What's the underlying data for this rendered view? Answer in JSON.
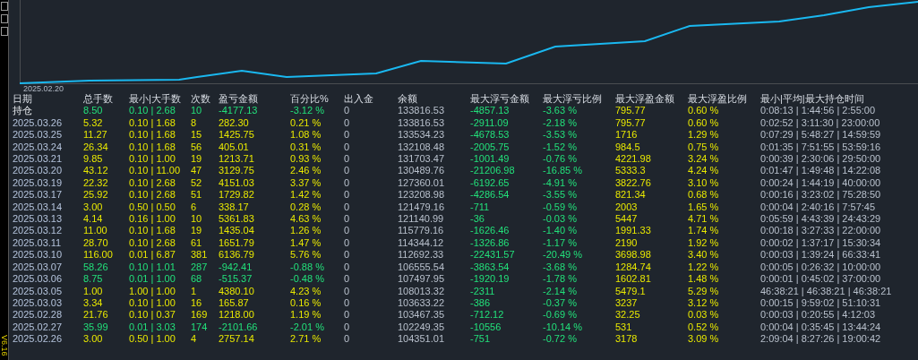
{
  "sidebar": {
    "version": "V6.16"
  },
  "chart": {
    "start_label": "2025.02.20"
  },
  "table": {
    "columns": [
      "日期",
      "总手数",
      "最小|大手数",
      "次数",
      "盈亏金额",
      "百分比%",
      "出入金",
      "余额",
      "最大浮亏金额",
      "最大浮亏比例",
      "最大浮盈金额",
      "最大浮盈比例",
      "最小|平均|最大持仓时间"
    ],
    "rows": [
      {
        "kind": "loss",
        "cells": [
          "持仓",
          "8.50",
          "0.10 | 2.68",
          "10",
          "-4177.13",
          "-3.12 %",
          "0",
          "133816.53",
          "-4857.13",
          "-3.63 %",
          "795.77",
          "0.60 %",
          "0:08:13 | 1:44:56 | 2:55:00"
        ]
      },
      {
        "kind": "profit",
        "cells": [
          "2025.03.26",
          "5.32",
          "0.10 | 1.68",
          "8",
          "282.30",
          "0.21 %",
          "0",
          "133816.53",
          "-2911.09",
          "-2.18 %",
          "795.77",
          "0.60 %",
          "0:02:52 | 3:11:30 | 23:00:00"
        ]
      },
      {
        "kind": "profit",
        "cells": [
          "2025.03.25",
          "11.27",
          "0.10 | 1.68",
          "15",
          "1425.75",
          "1.08 %",
          "0",
          "133534.23",
          "-4678.53",
          "-3.53 %",
          "1716",
          "1.29 %",
          "0:07:29 | 5:48:27 | 14:59:59"
        ]
      },
      {
        "kind": "profit",
        "cells": [
          "2025.03.24",
          "26.34",
          "0.10 | 1.68",
          "56",
          "405.01",
          "0.31 %",
          "0",
          "132108.48",
          "-2005.75",
          "-1.52 %",
          "984.5",
          "0.75 %",
          "0:01:35 | 7:51:55 | 53:59:16"
        ]
      },
      {
        "kind": "profit",
        "cells": [
          "2025.03.21",
          "9.85",
          "0.10 | 1.00",
          "19",
          "1213.71",
          "0.93 %",
          "0",
          "131703.47",
          "-1001.49",
          "-0.76 %",
          "4221.98",
          "3.24 %",
          "0:00:39 | 2:30:06 | 29:50:00"
        ]
      },
      {
        "kind": "profit",
        "cells": [
          "2025.03.20",
          "43.12",
          "0.10 | 11.00",
          "47",
          "3129.75",
          "2.46 %",
          "0",
          "130489.76",
          "-21206.98",
          "-16.85 %",
          "5333.3",
          "4.24 %",
          "0:01:47 | 1:49:48 | 14:22:08"
        ]
      },
      {
        "kind": "profit",
        "cells": [
          "2025.03.19",
          "22.32",
          "0.10 | 2.68",
          "52",
          "4151.03",
          "3.37 %",
          "0",
          "127360.01",
          "-6192.65",
          "-4.91 %",
          "3822.76",
          "3.10 %",
          "0:00:24 | 1:44:19 | 40:00:00"
        ]
      },
      {
        "kind": "profit",
        "cells": [
          "2025.03.17",
          "25.92",
          "0.10 | 2.68",
          "51",
          "1729.82",
          "1.42 %",
          "0",
          "123208.98",
          "-4286.54",
          "-3.55 %",
          "821.34",
          "0.68 %",
          "0:00:16 | 3:23:02 | 75:28:50"
        ]
      },
      {
        "kind": "profit",
        "cells": [
          "2025.03.14",
          "3.00",
          "0.50 | 0.50",
          "6",
          "338.17",
          "0.28 %",
          "0",
          "121479.16",
          "-711",
          "-0.59 %",
          "2003",
          "1.65 %",
          "0:00:04 | 2:40:16 | 7:57:45"
        ]
      },
      {
        "kind": "profit",
        "cells": [
          "2025.03.13",
          "4.14",
          "0.16 | 1.00",
          "10",
          "5361.83",
          "4.63 %",
          "0",
          "121140.99",
          "-36",
          "-0.03 %",
          "5447",
          "4.71 %",
          "0:05:59 | 4:43:39 | 24:43:29"
        ]
      },
      {
        "kind": "profit",
        "cells": [
          "2025.03.12",
          "11.00",
          "0.10 | 1.68",
          "19",
          "1435.04",
          "1.26 %",
          "0",
          "115779.16",
          "-1626.46",
          "-1.40 %",
          "1991.33",
          "1.74 %",
          "0:00:18 | 3:27:33 | 22:00:00"
        ]
      },
      {
        "kind": "profit",
        "cells": [
          "2025.03.11",
          "28.70",
          "0.10 | 2.68",
          "61",
          "1651.79",
          "1.47 %",
          "0",
          "114344.12",
          "-1326.86",
          "-1.17 %",
          "2190",
          "1.92 %",
          "0:00:02 | 1:37:17 | 15:30:34"
        ]
      },
      {
        "kind": "profit",
        "cells": [
          "2025.03.10",
          "116.00",
          "0.01 | 6.87",
          "381",
          "6136.79",
          "5.76 %",
          "0",
          "112692.33",
          "-22431.57",
          "-20.49 %",
          "3698.98",
          "3.40 %",
          "0:00:03 | 1:39:24 | 66:33:41"
        ]
      },
      {
        "kind": "loss",
        "cells": [
          "2025.03.07",
          "58.26",
          "0.10 | 1.01",
          "287",
          "-942.41",
          "-0.88 %",
          "0",
          "106555.54",
          "-3863.54",
          "-3.68 %",
          "1284.74",
          "1.22 %",
          "0:00:05 | 0:26:32 | 10:00:00"
        ]
      },
      {
        "kind": "loss",
        "cells": [
          "2025.03.06",
          "8.75",
          "0.01 | 1.00",
          "68",
          "-515.37",
          "-0.48 %",
          "0",
          "107497.95",
          "-1920.19",
          "-1.78 %",
          "1602.81",
          "1.48 %",
          "0:00:01 | 0:45:02 | 37:00:00"
        ]
      },
      {
        "kind": "profit",
        "cells": [
          "2025.03.05",
          "1.00",
          "1.00 | 1.00",
          "1",
          "4380.10",
          "4.23 %",
          "0",
          "108013.32",
          "-2311",
          "-2.14 %",
          "5479.1",
          "5.29 %",
          "46:38:21 | 46:38:21 | 46:38:21"
        ]
      },
      {
        "kind": "profit",
        "cells": [
          "2025.03.03",
          "3.34",
          "0.10 | 1.00",
          "16",
          "165.87",
          "0.16 %",
          "0",
          "103633.22",
          "-386",
          "-0.37 %",
          "3237",
          "3.12 %",
          "0:00:15 | 9:59:02 | 51:10:31"
        ]
      },
      {
        "kind": "profit",
        "cells": [
          "2025.02.28",
          "21.76",
          "0.10 | 0.37",
          "169",
          "1218.00",
          "1.19 %",
          "0",
          "103467.35",
          "-712.12",
          "-0.69 %",
          "32.25",
          "0.03 %",
          "0:00:03 | 0:20:55 | 4:12:03"
        ]
      },
      {
        "kind": "loss",
        "cells": [
          "2025.02.27",
          "35.99",
          "0.01 | 3.03",
          "174",
          "-2101.66",
          "-2.01 %",
          "0",
          "102249.35",
          "-10556",
          "-10.14 %",
          "531",
          "0.52 %",
          "0:00:04 | 0:35:45 | 13:44:24"
        ]
      },
      {
        "kind": "profit",
        "cells": [
          "2025.02.26",
          "3.00",
          "0.50 | 1.00",
          "4",
          "2757.14",
          "2.71 %",
          "0",
          "104351.01",
          "-751",
          "-0.72 %",
          "3178",
          "3.09 %",
          "2:09:04 | 8:27:26 | 19:00:42"
        ]
      }
    ]
  }
}
